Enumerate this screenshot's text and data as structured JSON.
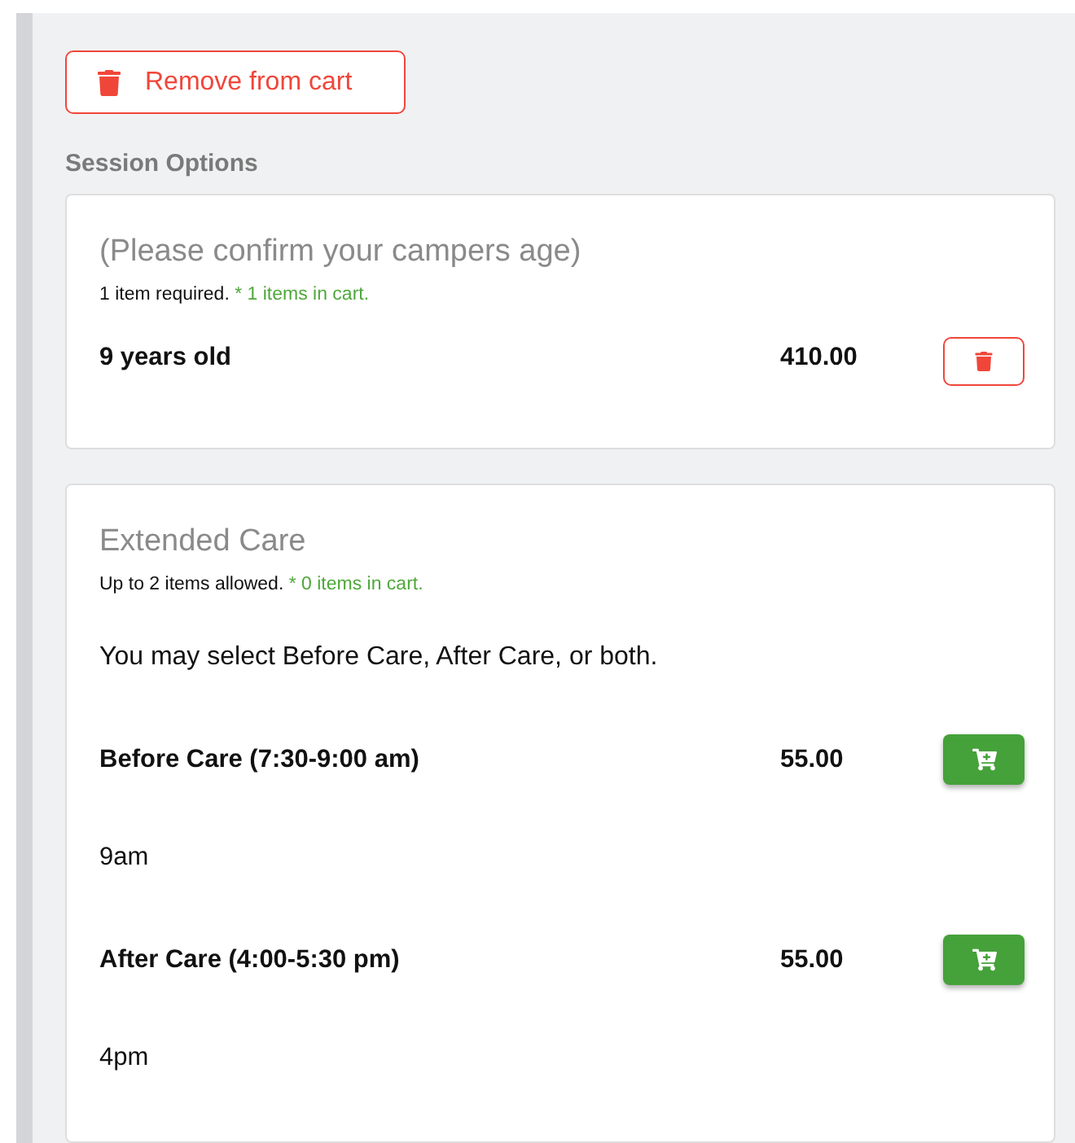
{
  "remove_button": {
    "label": "Remove from cart"
  },
  "section_title": "Session Options",
  "groups": [
    {
      "title": "(Please confirm your campers age)",
      "rule": "1 item required.",
      "cart_note": "* 1 items in cart.",
      "items": [
        {
          "name": "9 years old",
          "price": "410.00",
          "kind": "in_cart"
        }
      ]
    },
    {
      "title": "Extended Care",
      "rule": "Up to 2 items allowed.",
      "cart_note": "* 0 items in cart.",
      "intro": "You may select Before Care, After Care, or both.",
      "items": [
        {
          "name": "Before Care (7:30-9:00 am)",
          "price": "55.00",
          "kind": "available",
          "detail": "9am"
        },
        {
          "name": "After Care (4:00-5:30 pm)",
          "price": "55.00",
          "kind": "available",
          "detail": "4pm"
        }
      ]
    }
  ]
}
